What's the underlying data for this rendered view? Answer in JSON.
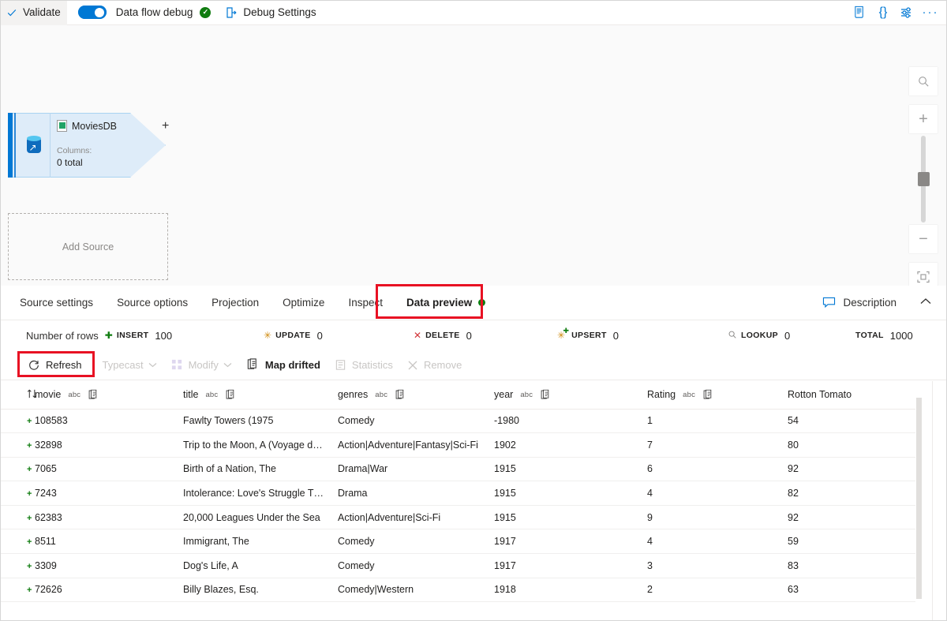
{
  "toolbar": {
    "validate": "Validate",
    "data_flow_debug": "Data flow debug",
    "debug_settings": "Debug Settings",
    "icons": {
      "validate": "checkmark-icon",
      "debug_status": "green-check-icon",
      "debug_settings": "debug-settings-icon",
      "code_view": "script-icon",
      "json_view": "braces-icon",
      "settings": "sliders-icon",
      "more": "ellipsis-icon"
    },
    "code_view_label": "{}",
    "more_label": "···"
  },
  "canvas": {
    "source_node": {
      "name": "MoviesDB",
      "columns_label": "Columns:",
      "columns_total": "0 total",
      "plus": "+"
    },
    "add_source": "Add Source",
    "controls": {
      "search": "search-icon",
      "zoom_in": "+",
      "zoom_out": "−",
      "fit": "fit-to-screen-icon"
    }
  },
  "tabs": {
    "items": [
      {
        "label": "Source settings",
        "active": false
      },
      {
        "label": "Source options",
        "active": false
      },
      {
        "label": "Projection",
        "active": false
      },
      {
        "label": "Optimize",
        "active": false
      },
      {
        "label": "Inspect",
        "active": false
      },
      {
        "label": "Data preview",
        "active": true,
        "status_dot": "#107c10"
      }
    ],
    "description": "Description",
    "collapse": "∧"
  },
  "stats": {
    "lead_label": "Number of rows",
    "items": [
      {
        "key": "INSERT",
        "value": "100",
        "color": "#107c10"
      },
      {
        "key": "UPDATE",
        "value": "0",
        "color": "#d08b10"
      },
      {
        "key": "DELETE",
        "value": "0",
        "color": "#d13438"
      },
      {
        "key": "UPSERT",
        "value": "0",
        "color": "#d08b10"
      },
      {
        "key": "LOOKUP",
        "value": "0",
        "color": "#8a8886"
      },
      {
        "key": "TOTAL",
        "value": "1000",
        "color": "#201f1e"
      }
    ]
  },
  "actions": {
    "refresh": "Refresh",
    "typecast": "Typecast",
    "modify": "Modify",
    "map_drifted": "Map drifted",
    "statistics": "Statistics",
    "remove": "Remove",
    "caret": "∨"
  },
  "table": {
    "sort_icon": "sort-icon",
    "type_tag": "abc",
    "columns": [
      {
        "name": "movie",
        "type": "abc",
        "has_map_icon": true
      },
      {
        "name": "title",
        "type": "abc",
        "has_map_icon": true
      },
      {
        "name": "genres",
        "type": "abc",
        "has_map_icon": true
      },
      {
        "name": "year",
        "type": "abc",
        "has_map_icon": true
      },
      {
        "name": "Rating",
        "type": "abc",
        "has_map_icon": true
      },
      {
        "name": "Rotton Tomato",
        "type": "",
        "has_map_icon": false
      }
    ],
    "rows": [
      {
        "marker": "+",
        "movie": "108583",
        "title": "Fawlty Towers (1975",
        "genres": "Comedy",
        "year": "-1980",
        "rating": "1",
        "rotton_tomato": "54"
      },
      {
        "marker": "+",
        "movie": "32898",
        "title": "Trip to the Moon, A (Voyage d…",
        "genres": "Action|Adventure|Fantasy|Sci-Fi",
        "year": "1902",
        "rating": "7",
        "rotton_tomato": "80"
      },
      {
        "marker": "+",
        "movie": "7065",
        "title": "Birth of a Nation, The",
        "genres": "Drama|War",
        "year": "1915",
        "rating": "6",
        "rotton_tomato": "92"
      },
      {
        "marker": "+",
        "movie": "7243",
        "title": "Intolerance: Love's Struggle T…",
        "genres": "Drama",
        "year": "1915",
        "rating": "4",
        "rotton_tomato": "82"
      },
      {
        "marker": "+",
        "movie": "62383",
        "title": "20,000 Leagues Under the Sea",
        "genres": "Action|Adventure|Sci-Fi",
        "year": "1915",
        "rating": "9",
        "rotton_tomato": "92"
      },
      {
        "marker": "+",
        "movie": "8511",
        "title": "Immigrant, The",
        "genres": "Comedy",
        "year": "1917",
        "rating": "4",
        "rotton_tomato": "59"
      },
      {
        "marker": "+",
        "movie": "3309",
        "title": "Dog's Life, A",
        "genres": "Comedy",
        "year": "1917",
        "rating": "3",
        "rotton_tomato": "83"
      },
      {
        "marker": "+",
        "movie": "72626",
        "title": "Billy Blazes, Esq.",
        "genres": "Comedy|Western",
        "year": "1918",
        "rating": "2",
        "rotton_tomato": "63"
      }
    ]
  },
  "annotations": {
    "color": "#e81123",
    "boxes": [
      "data-preview-tab",
      "refresh-button"
    ]
  }
}
